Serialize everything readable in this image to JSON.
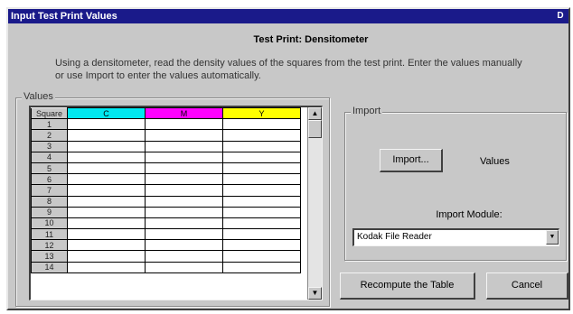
{
  "window": {
    "title": "Input Test Print Values",
    "close_glyph": "D"
  },
  "heading": "Test Print: Densitometer",
  "instructions": "Using a densitometer, read the density values of the squares from the test print. Enter the values manually or use Import to enter the values automatically.",
  "values_group": {
    "label": "Values",
    "columns": [
      "Square",
      "C",
      "M",
      "Y"
    ],
    "column_colors": [
      "#c8c8c8",
      "#00e8f0",
      "#ff00ff",
      "#ffff00"
    ],
    "rows": [
      "1",
      "2",
      "3",
      "4",
      "5",
      "6",
      "7",
      "8",
      "9",
      "10",
      "11",
      "12",
      "13",
      "14"
    ]
  },
  "import_group": {
    "label": "Import",
    "import_button": "Import...",
    "values_label": "Values",
    "module_label": "Import Module:",
    "module_selected": "Kodak File Reader"
  },
  "buttons": {
    "recompute": "Recompute the Table",
    "cancel": "Cancel"
  },
  "icons": {
    "scroll_up": "scroll-up-arrow-icon",
    "scroll_down": "scroll-down-arrow-icon",
    "dropdown": "dropdown-arrow-icon"
  }
}
